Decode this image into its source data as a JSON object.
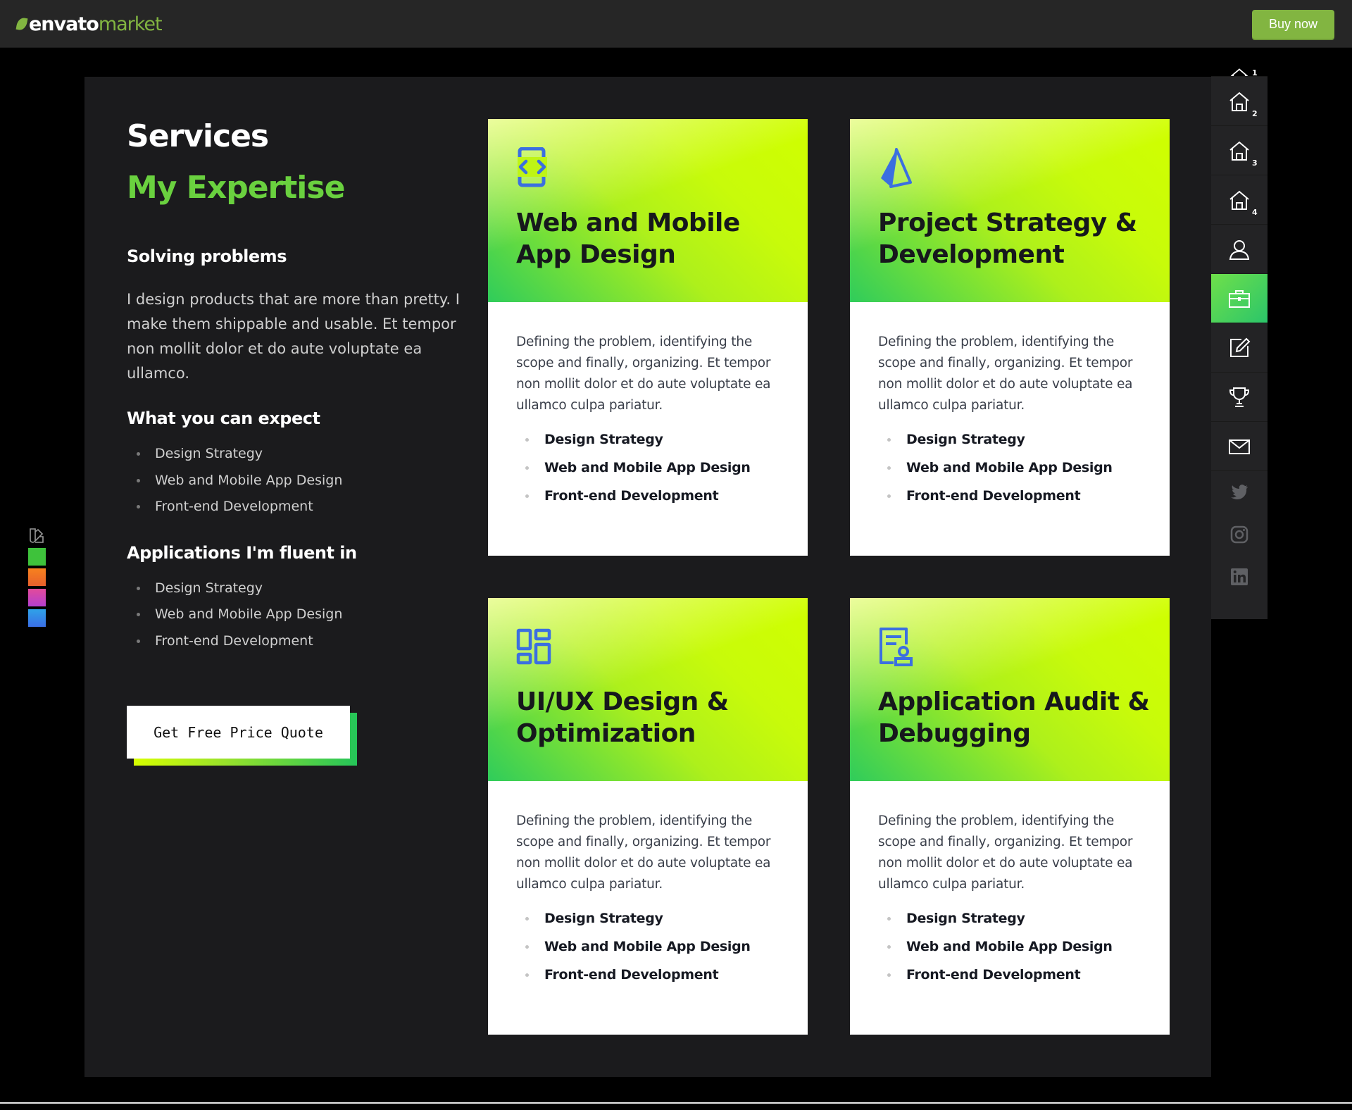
{
  "topbar": {
    "logo_envato": "envato",
    "logo_market": "market",
    "buy_label": "Buy now"
  },
  "services": {
    "kicker": "Services",
    "headline": "My Expertise",
    "solving_title": "Solving problems",
    "intro": "I design products that are more than pretty. I make them shippable and usable. Et tempor non mollit dolor et do aute voluptate ea ullamco.",
    "expect_title": "What you can expect",
    "expect_items": [
      "Design Strategy",
      "Web and Mobile App Design",
      "Front-end Development"
    ],
    "apps_title": "Applications I'm fluent in",
    "apps_items": [
      "Design Strategy",
      "Web and Mobile App Design",
      "Front-end Development"
    ],
    "cta_label": "Get Free Price Quote"
  },
  "cards": [
    {
      "icon": "code-icon",
      "title": "Web and Mobile App Design",
      "description": "Defining the problem, identifying the scope and finally, organizing. Et tempor non mollit dolor et do aute voluptate ea ullamco culpa pariatur.",
      "items": [
        "Design Strategy",
        "Web and Mobile App Design",
        "Front-end Development"
      ]
    },
    {
      "icon": "prism-icon",
      "title": "Project Strategy & Development",
      "description": "Defining the problem, identifying the scope and finally, organizing. Et tempor non mollit dolor et do aute voluptate ea ullamco culpa pariatur.",
      "items": [
        "Design Strategy",
        "Web and Mobile App Design",
        "Front-end Development"
      ]
    },
    {
      "icon": "dashboard-icon",
      "title": "UI/UX Design & Optimization",
      "description": "Defining the problem, identifying the scope and finally, organizing. Et tempor non mollit dolor et do aute voluptate ea ullamco culpa pariatur.",
      "items": [
        "Design Strategy",
        "Web and Mobile App Design",
        "Front-end Development"
      ]
    },
    {
      "icon": "certificate-icon",
      "title": "Application Audit & Debugging",
      "description": "Defining the problem, identifying the scope and finally, organizing. Et tempor non mollit dolor et do aute voluptate ea ullamco culpa pariatur.",
      "items": [
        "Design Strategy",
        "Web and Mobile App Design",
        "Front-end Development"
      ]
    }
  ],
  "nav": {
    "home_numbers": [
      "1",
      "2",
      "3",
      "4"
    ],
    "active_item": "briefcase-icon",
    "items": [
      "home-icon",
      "home-icon",
      "home-icon",
      "home-icon",
      "user-icon",
      "briefcase-icon",
      "edit-icon",
      "trophy-icon",
      "mail-icon"
    ],
    "social": [
      "twitter-icon",
      "instagram-icon",
      "linkedin-icon"
    ]
  },
  "color_switcher": {
    "swatches": [
      "#3ec23b",
      "#f07b22",
      "#d944a8",
      "#3a8ee6"
    ]
  },
  "colors": {
    "accent": "#6ad13f",
    "buy_button": "#82b541",
    "icon_blue": "#3b6fe0"
  }
}
